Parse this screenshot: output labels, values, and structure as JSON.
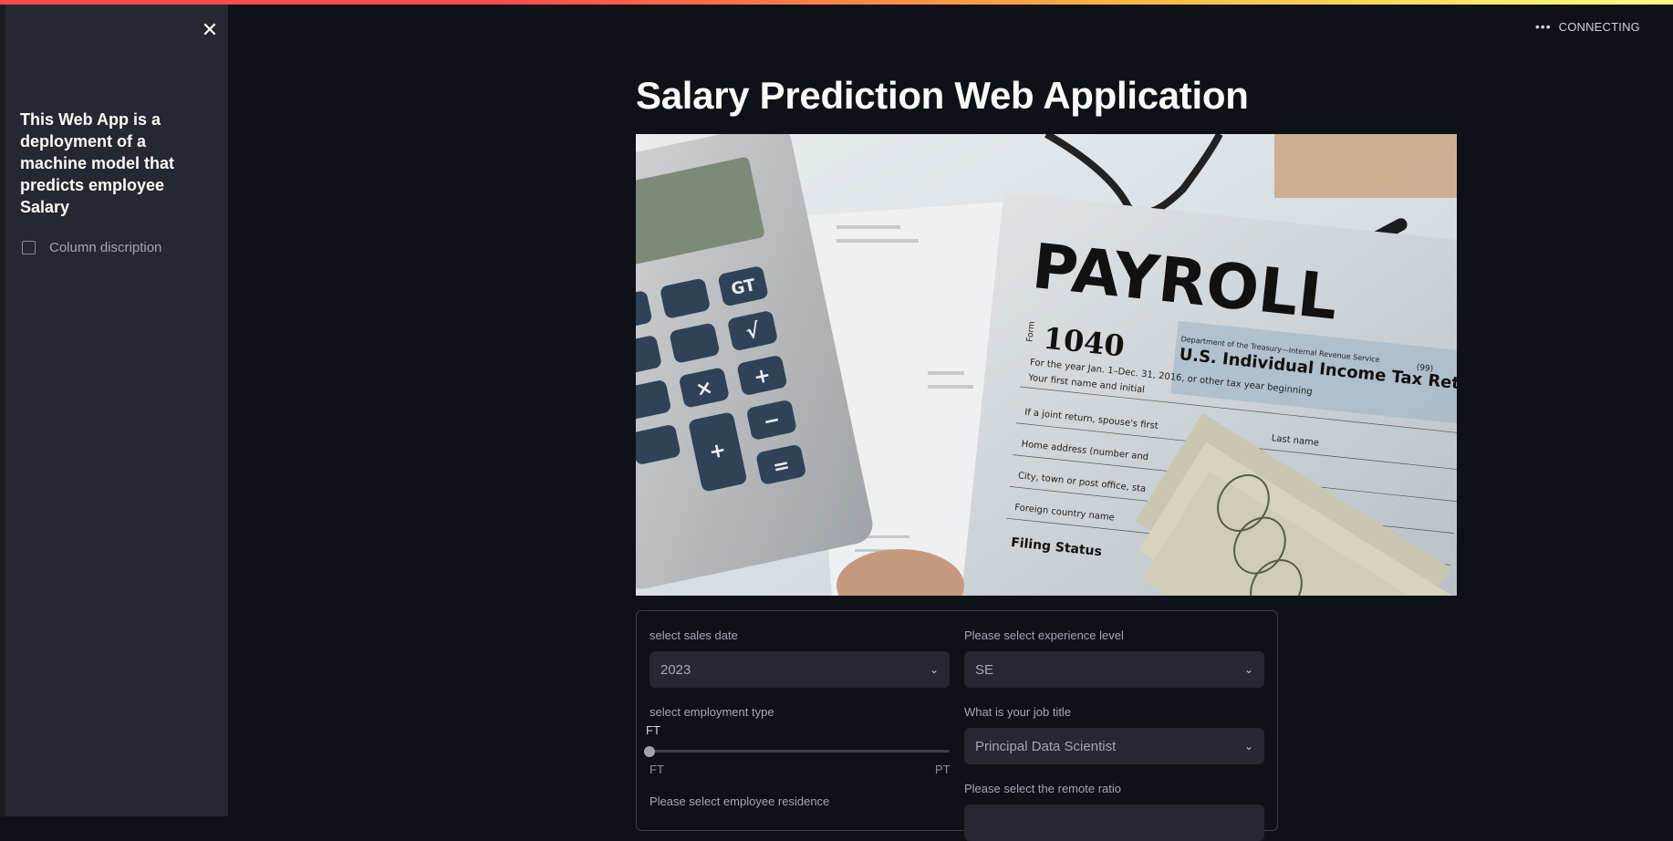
{
  "sidebar": {
    "close_label": "✕",
    "description": "This Web App is a deployment of a machine model that predicts employee Salary",
    "checkbox_label": "Column discription"
  },
  "header": {
    "status_text": "CONNECTING",
    "status_icon": "more-horizontal-icon",
    "menu_icon": "vertical-dots-icon"
  },
  "main": {
    "title": "Salary Prediction Web Application",
    "hero_image": {
      "icon": "payroll-image",
      "heading": "PAYROLL",
      "form_number": "1040",
      "form_prefix": "Form",
      "department": "Department of the Treasury—Internal Revenue Service",
      "form_title": "U.S. Individual Income Tax Return",
      "year_line": "For the year Jan. 1–Dec. 31, 2016, or other tax year beginning",
      "first_name": "Your first name and initial",
      "last_name": "Last name",
      "joint": "If a joint return, spouse's first",
      "home": "Home address (number and",
      "city": "City, town or post office, sta",
      "foreign": "Foreign country name",
      "filing": "Filing Status",
      "code": "(99)"
    },
    "form": {
      "sales_date": {
        "label": "select sales date",
        "value": "2023"
      },
      "experience": {
        "label": "Please select experience level",
        "value": "SE"
      },
      "employment": {
        "label": "select employment type",
        "current": "FT",
        "min": "FT",
        "max": "PT",
        "position": 0
      },
      "job_title": {
        "label": "What is your job title",
        "value": "Principal Data Scientist"
      },
      "residence": {
        "label": "Please select employee residence"
      },
      "remote": {
        "label": "Please select the remote ratio"
      }
    }
  },
  "colors": {
    "background": "#0e1117",
    "sidebar": "#262730",
    "accent_red": "#ff4b4b",
    "accent_yellow": "#fffd80"
  }
}
